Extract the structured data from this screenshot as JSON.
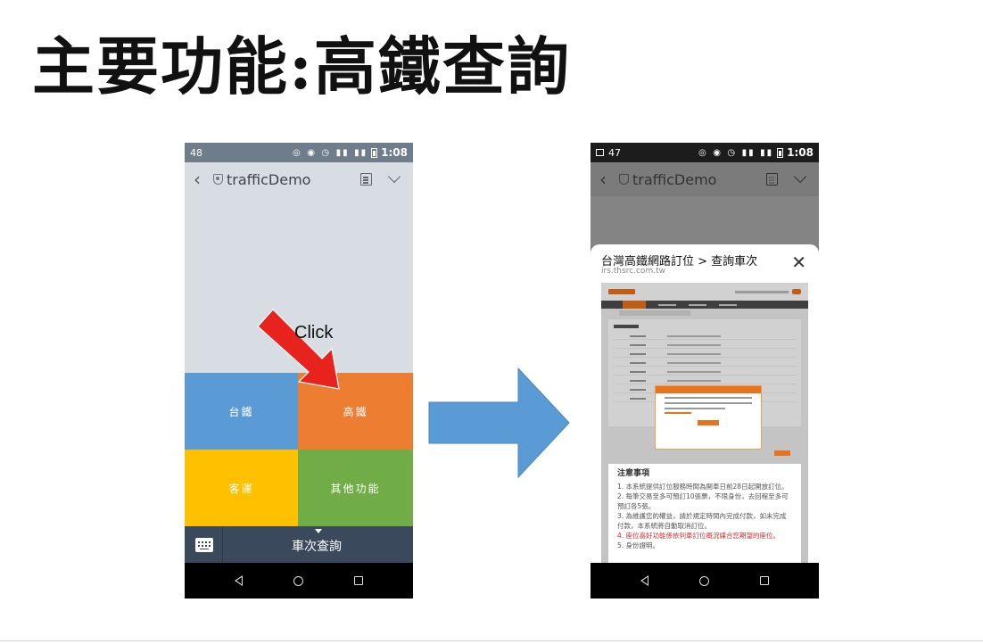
{
  "slide": {
    "title": "主要功能:高鐵查詢"
  },
  "annotation": {
    "click_label": "Click"
  },
  "phone_left": {
    "status": {
      "left": "48",
      "time": "1:08"
    },
    "header": {
      "title": "trafficDemo"
    },
    "tiles": [
      {
        "label": "台鐵"
      },
      {
        "label": "高鐵"
      },
      {
        "label": "客運"
      },
      {
        "label": "其他功能"
      }
    ],
    "bottom_menu": {
      "label": "車次查詢"
    }
  },
  "phone_right": {
    "status": {
      "left": "47",
      "time": "1:08"
    },
    "header": {
      "title": "trafficDemo"
    },
    "sheet": {
      "title": "台灣高鐵網路訂位 > 查詢車次",
      "url": "irs.thsrc.com.tw"
    },
    "notice": {
      "title": "注意事項",
      "items": [
        "1. 本系統提供訂位服務時間為開車日前28日起開放訂位。",
        "2. 每筆交易至多可預訂10張票，不限身份，去回程至多可預訂各5張。",
        "3. 為維護您的權益，請於規定時間內完成付款，如未完成付款，本系統將自動取消訂位。",
        "4. 座位喜好功能係依列車訂位概況媒合您期望的座位。",
        "5. 身份證明。"
      ]
    }
  },
  "colors": {
    "tile_taiwan_rail": "#5b9bd5",
    "tile_hsr": "#ed7d31",
    "tile_bus": "#ffc000",
    "tile_other": "#70ad47",
    "menu_bar": "#3a4a5c",
    "arrow_red": "#e8231e",
    "arrow_blue": "#5b9bd5"
  }
}
